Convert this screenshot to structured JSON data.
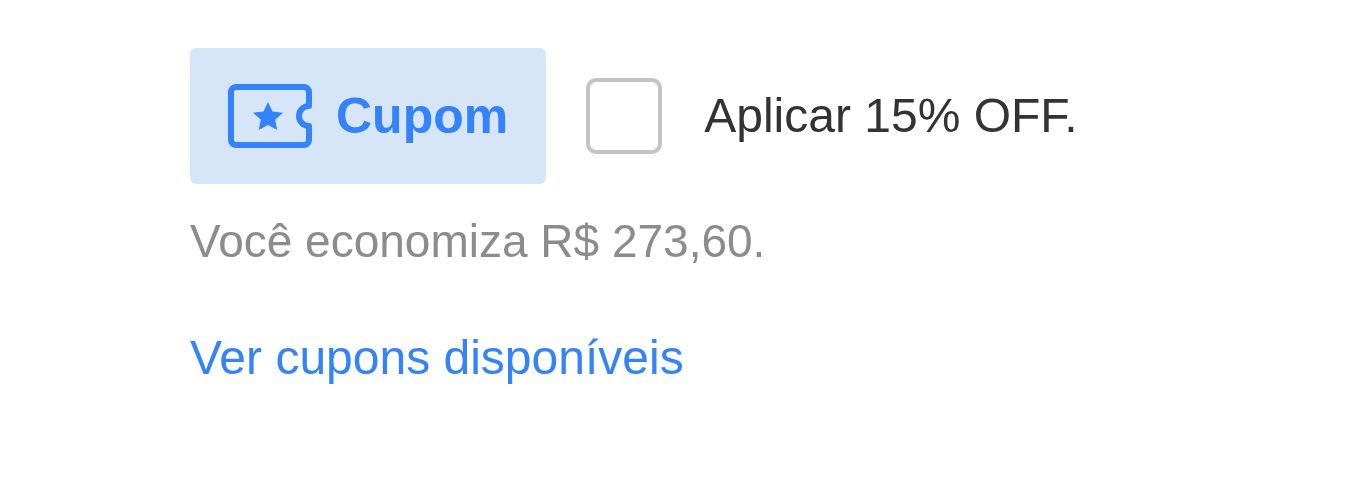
{
  "coupon_badge": {
    "label": "Cupom"
  },
  "discount_option": {
    "label": "Aplicar 15% OFF.",
    "checked": false
  },
  "savings_text": "Você economiza R$ 273,60.",
  "coupons_link": "Ver cupons disponíveis"
}
